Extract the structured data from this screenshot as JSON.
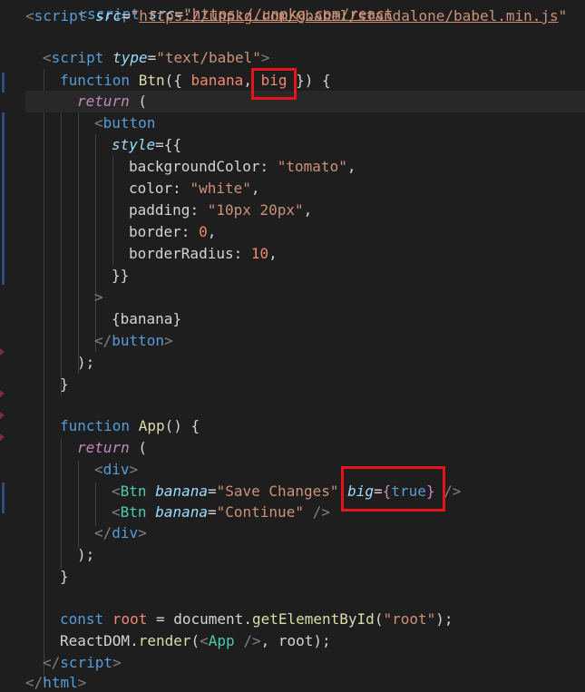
{
  "code": {
    "l1_a": "<",
    "l1_tag": "script",
    "l1_attr": "src",
    "l1_eq": "=",
    "l1_q1": "\"",
    "l1_url": "https://unpkg.com/@babel/standalone/babel.min.js",
    "l1_q2": "\"",
    "l3_a": "<",
    "l3_tag": "script",
    "l3_attr": "type",
    "l3_eq": "=",
    "l3_str": "\"text/babel\"",
    "l3_b": ">",
    "l4_kw": "function",
    "l4_fn": "Btn",
    "l4_p1": "({ ",
    "l4_banana": "banana",
    "l4_comma": ", ",
    "l4_big": "big",
    "l4_p2": " }) {",
    "l5_ret": "return",
    "l5_p": " (",
    "l6_a": "<",
    "l6_tag": "button",
    "l7_attr": "style",
    "l7_p": "={{",
    "l8_prop": "backgroundColor",
    "l8_c": ": ",
    "l8_str": "\"tomato\"",
    "l8_e": ",",
    "l9_prop": "color",
    "l9_c": ": ",
    "l9_str": "\"white\"",
    "l9_e": ",",
    "l10_prop": "padding",
    "l10_c": ": ",
    "l10_str": "\"10px 20px\"",
    "l10_e": ",",
    "l11_prop": "border",
    "l11_c": ": ",
    "l11_num": "0",
    "l11_e": ",",
    "l12_prop": "borderRadius",
    "l12_c": ": ",
    "l12_num": "10",
    "l12_e": ",",
    "l13": "}}",
    "l14": ">",
    "l15_a": "{",
    "l15_v": "banana",
    "l15_b": "}",
    "l16_a": "</",
    "l16_tag": "button",
    "l16_b": ">",
    "l17": ");",
    "l18": "}",
    "l20_kw": "function",
    "l20_fn": "App",
    "l20_p": "() {",
    "l21_ret": "return",
    "l21_p": " (",
    "l22_a": "<",
    "l22_tag": "div",
    "l22_b": ">",
    "l23_a": "<",
    "l23_comp": "Btn",
    "l23_attr": "banana",
    "l23_eq": "=",
    "l23_str": "\"Save Changes\"",
    "l23_big": "big",
    "l23_eq2": "=",
    "l23_br1": "{",
    "l23_true": "true",
    "l23_br2": "}",
    "l23_end": " />",
    "l24_a": "<",
    "l24_comp": "Btn",
    "l24_attr": "banana",
    "l24_eq": "=",
    "l24_str": "\"Continue\"",
    "l24_end": " />",
    "l25_a": "</",
    "l25_tag": "div",
    "l25_b": ">",
    "l26": ");",
    "l27": "}",
    "l29_kw": "const",
    "l29_var": "root",
    "l29_eq": " = ",
    "l29_doc": "document",
    "l29_dot": ".",
    "l29_fn": "getElementById",
    "l29_p1": "(",
    "l29_str": "\"root\"",
    "l29_p2": ");",
    "l30_obj": "ReactDOM",
    "l30_dot": ".",
    "l30_fn": "render",
    "l30_p1": "(",
    "l30_a": "<",
    "l30_comp": "App",
    "l30_b": " />",
    "l30_p2": ", root);",
    "l31_a": "</",
    "l31_tag": "script",
    "l31_b": ">",
    "l32_a": "</",
    "l32_tag": "html",
    "l32_b": ">"
  },
  "colors": {
    "background": "#1e1e1e",
    "highlight_box": "#e8141c",
    "keyword": "#569cd6",
    "function_name": "#dcdcaa",
    "string": "#ce9178",
    "parameter": "#f48771",
    "component": "#4ec9b0",
    "number": "#b5cea8",
    "attribute": "#9cdcfe"
  }
}
